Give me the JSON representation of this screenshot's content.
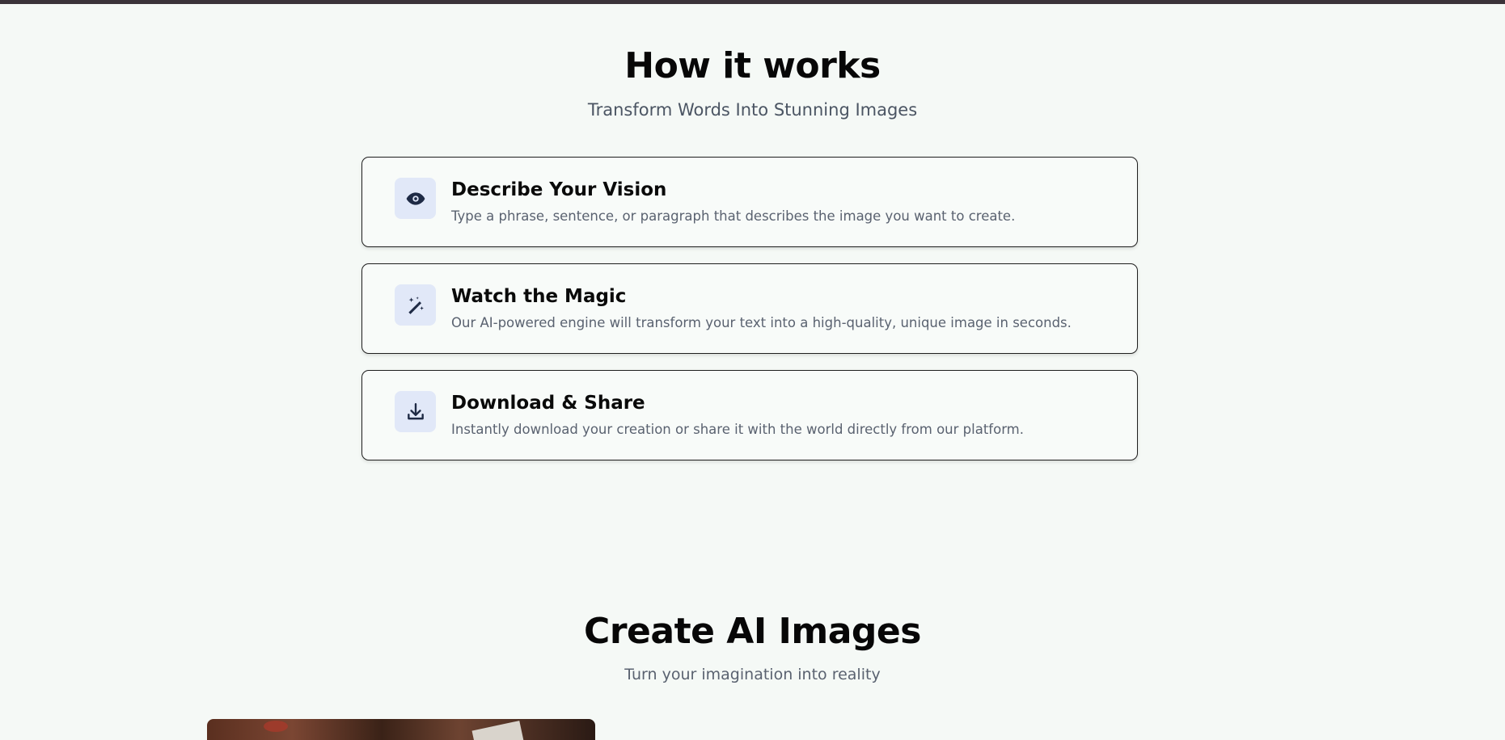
{
  "how_it_works": {
    "title": "How it works",
    "subtitle": "Transform Words Into Stunning Images",
    "steps": [
      {
        "icon": "eye-icon",
        "title": "Describe Your Vision",
        "description": "Type a phrase, sentence, or paragraph that describes the image you want to create."
      },
      {
        "icon": "magic-wand-icon",
        "title": "Watch the Magic",
        "description": "Our AI-powered engine will transform your text into a high-quality, unique image in seconds."
      },
      {
        "icon": "download-icon",
        "title": "Download & Share",
        "description": "Instantly download your creation or share it with the world directly from our platform."
      }
    ]
  },
  "create_section": {
    "title": "Create AI Images",
    "subtitle": "Turn your imagination into reality"
  },
  "colors": {
    "background": "#f5f9f6",
    "icon_box": "#e1e8f8",
    "icon": "#1e2a45",
    "top_bar": "#3b3339"
  }
}
